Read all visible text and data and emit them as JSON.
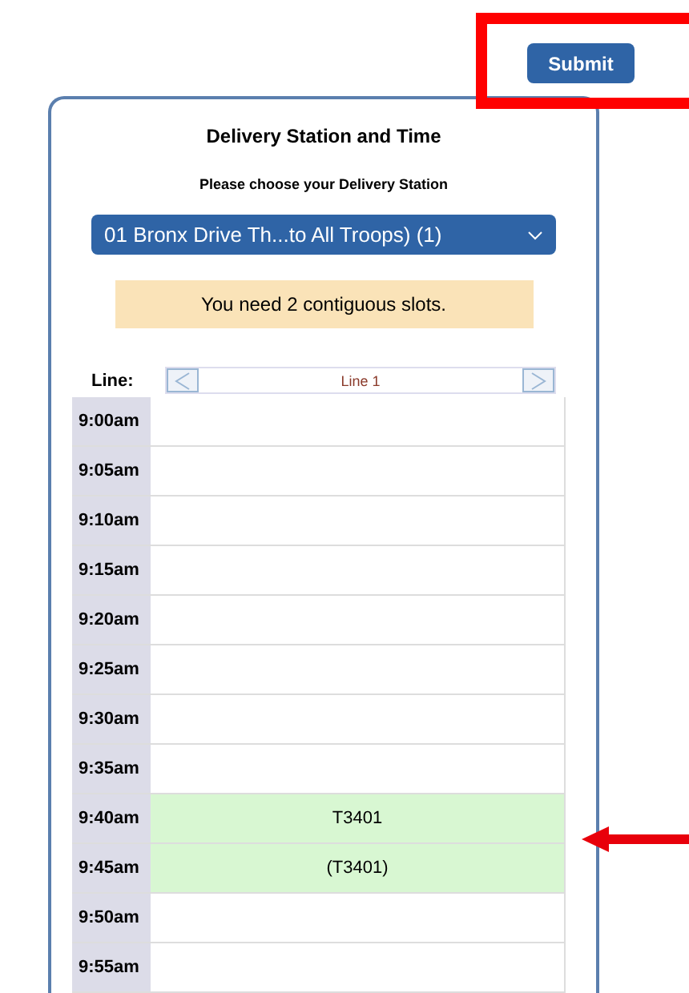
{
  "submit_button": "Submit",
  "panel": {
    "title": "Delivery Station and Time",
    "subtitle": "Please choose your Delivery Station",
    "station_select": "01 Bronx Drive Th...to All Troops) (1)",
    "notice": "You need 2 contiguous slots.",
    "line_label": "Line:",
    "line_name": "Line 1"
  },
  "slots": [
    {
      "time": "9:00am",
      "booked": false
    },
    {
      "time": "9:05am",
      "booked": false
    },
    {
      "time": "9:10am",
      "booked": false
    },
    {
      "time": "9:15am",
      "booked": false
    },
    {
      "time": "9:20am",
      "booked": false
    },
    {
      "time": "9:25am",
      "booked": false
    },
    {
      "time": "9:30am",
      "booked": false
    },
    {
      "time": "9:35am",
      "booked": false
    },
    {
      "time": "9:40am",
      "booked": true,
      "label": "T3401"
    },
    {
      "time": "9:45am",
      "booked": true,
      "label": "(T3401)"
    },
    {
      "time": "9:50am",
      "booked": false
    },
    {
      "time": "9:55am",
      "booked": false
    }
  ],
  "annotations": {
    "highlight_box": true,
    "pointer_arrow": true
  }
}
